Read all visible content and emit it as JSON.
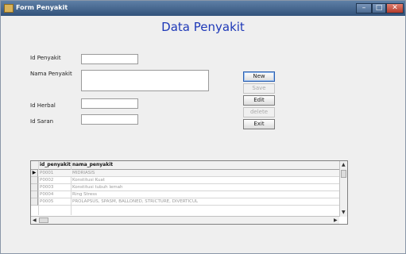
{
  "window": {
    "title": "Form Penyakit"
  },
  "form": {
    "title": "Data Penyakit",
    "labels": {
      "id_penyakit": "Id Penyakit",
      "nama_penyakit": "Nama Penyakit",
      "id_herbal": "Id Herbal",
      "id_saran": "Id Saran"
    },
    "values": {
      "id_penyakit": "",
      "nama_penyakit": "",
      "id_herbal": "",
      "id_saran": ""
    }
  },
  "buttons": {
    "new": "New",
    "save": "Save",
    "edit": "Edit",
    "delete": "delete",
    "exit": "Exit"
  },
  "grid": {
    "columns": [
      "id_penyakit",
      "nama_penyakit"
    ],
    "rows": [
      {
        "id": "P0001",
        "nama": "MIDRIASIS"
      },
      {
        "id": "P0002",
        "nama": "Konstitusi Kuat"
      },
      {
        "id": "P0003",
        "nama": "Konstitusi tubuh lemah"
      },
      {
        "id": "P0004",
        "nama": "Ring Stress"
      },
      {
        "id": "P0005",
        "nama": "PROLAPSUS, SPASM, BALLONED, STRICTURE, DIVERTICUL"
      }
    ]
  }
}
